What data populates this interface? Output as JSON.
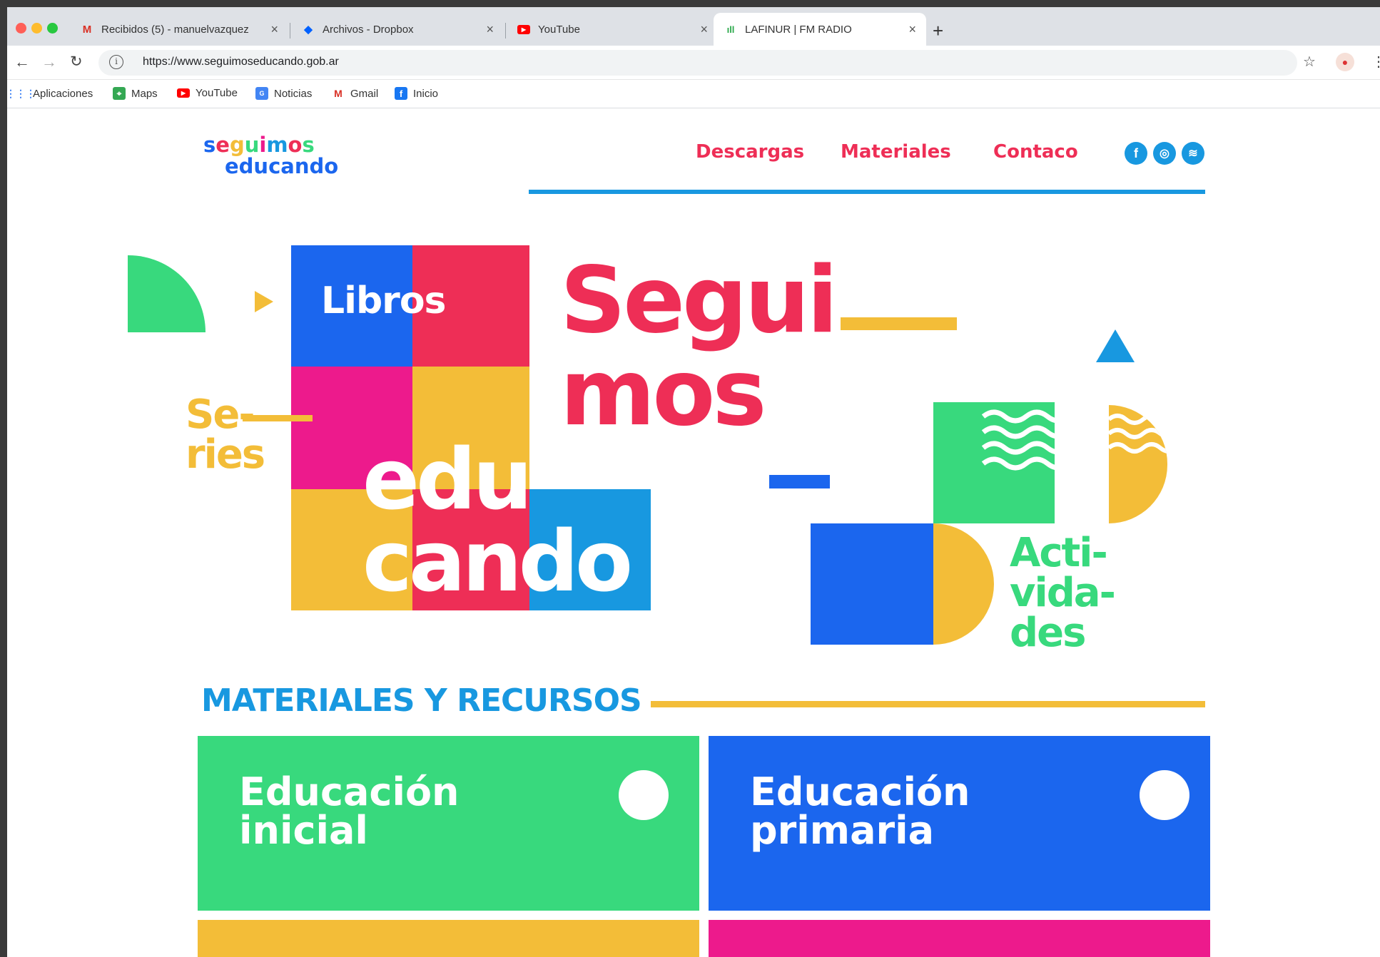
{
  "browser": {
    "tabs": [
      {
        "title": "Recibidos (5) - manuelvazquez",
        "icon": "gmail-icon"
      },
      {
        "title": "Archivos - Dropbox",
        "icon": "dropbox-icon"
      },
      {
        "title": "YouTube",
        "icon": "youtube-icon"
      },
      {
        "title": "LAFINUR | FM RADIO",
        "icon": "radio-icon"
      }
    ],
    "new_tab": "+",
    "url": "https://www.seguimoseducando.gob.ar",
    "bookmarks": [
      {
        "label": "Aplicaciones",
        "icon": "apps-grid-icon"
      },
      {
        "label": "Maps",
        "icon": "maps-icon"
      },
      {
        "label": "YouTube",
        "icon": "youtube-icon"
      },
      {
        "label": "Noticias",
        "icon": "news-icon"
      },
      {
        "label": "Gmail",
        "icon": "gmail-icon"
      },
      {
        "label": "Inicio",
        "icon": "facebook-icon"
      }
    ]
  },
  "site": {
    "logo_line1": "seguimos",
    "logo_line2": "educando",
    "nav": {
      "descargas": "Descargas",
      "materiales": "Materiales",
      "contacto": "Contaco"
    },
    "social": [
      "facebook-icon",
      "instagram-icon",
      "spotify-icon"
    ]
  },
  "hero": {
    "libros": "Libros",
    "segui": "Segui",
    "mos": "mos",
    "se": "Se-",
    "ries": "ries",
    "edu": "edu",
    "cando": "cando",
    "acti": "Acti-",
    "vida": "vida-",
    "des": "des"
  },
  "materiales": {
    "title": "MATERIALES Y RECURSOS",
    "cards": [
      {
        "line1": "Educación",
        "line2": "inicial"
      },
      {
        "line1": "Educación",
        "line2": "primaria"
      }
    ]
  },
  "colors": {
    "blue": "#1b66ee",
    "red": "#ee2e56",
    "pink": "#ed1a8c",
    "yellow": "#f3bd38",
    "green": "#38d97d",
    "cyan": "#1898e0"
  }
}
